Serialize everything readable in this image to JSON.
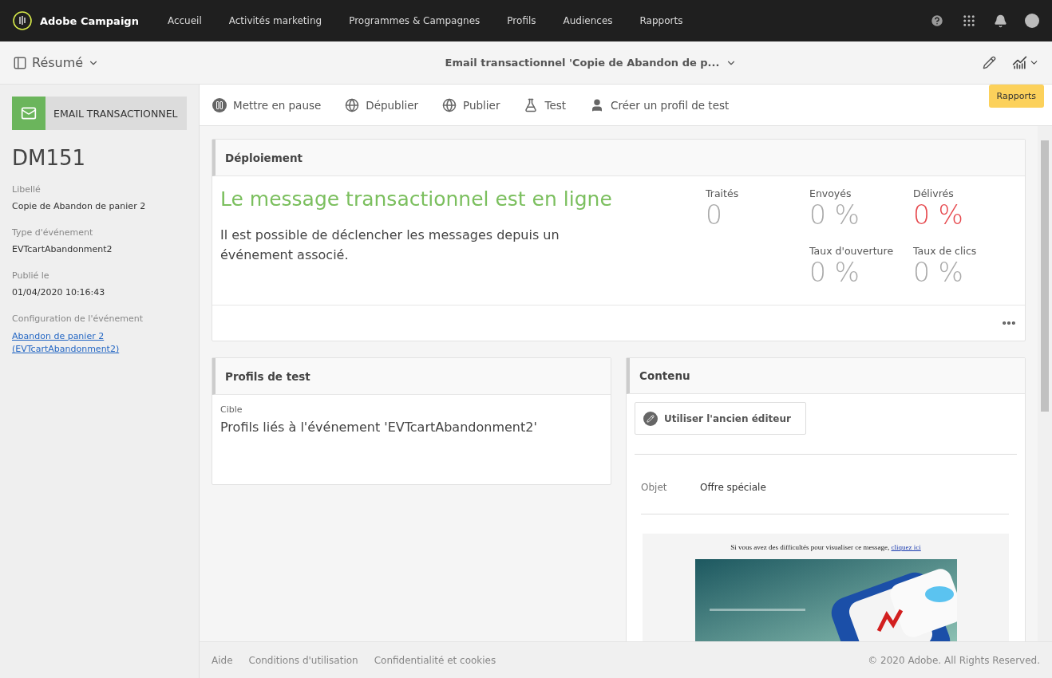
{
  "brand": "Adobe Campaign",
  "nav": [
    {
      "label": "Accueil",
      "selected": false
    },
    {
      "label": "Activités marketing",
      "selected": false
    },
    {
      "label": "Programmes & Campagnes",
      "selected": false
    },
    {
      "label": "Profils",
      "selected": false
    },
    {
      "label": "Audiences",
      "selected": false
    },
    {
      "label": "Rapports",
      "selected": false
    }
  ],
  "subbar": {
    "view": "Résumé",
    "title": "Email transactionnel 'Copie de Abandon de p...",
    "tooltip": "Rapports"
  },
  "sidebar": {
    "badge": "EMAIL TRANSACTIONNEL",
    "id": "DM151",
    "fields": [
      {
        "label": "Libellé",
        "value": "Copie de Abandon de panier 2",
        "kind": "text"
      },
      {
        "label": "Type d'événement",
        "value": "EVTcartAbandonment2",
        "kind": "text"
      },
      {
        "label": "Publié le",
        "value": "01/04/2020 10:16:43",
        "kind": "text"
      },
      {
        "label": "Configuration de l'événement",
        "value": "Abandon de panier 2 (EVTcartAbandonment2)",
        "kind": "link"
      }
    ]
  },
  "toolbar": [
    {
      "label": "Mettre en pause",
      "kind": "pause"
    },
    {
      "label": "Dépublier",
      "kind": "unpublish"
    },
    {
      "label": "Publier",
      "kind": "publish"
    },
    {
      "label": "Test",
      "kind": "test"
    },
    {
      "label": "Créer un profil de test",
      "kind": "profile"
    }
  ],
  "deployment": {
    "title": "Déploiement",
    "status": "Le message transactionnel est en ligne",
    "description": "Il est possible de déclencher les messages depuis un événement associé.",
    "stats": [
      {
        "label": "Traités",
        "value": "0",
        "alert": false
      },
      {
        "label": "Envoyés",
        "value": "0 %",
        "alert": false
      },
      {
        "label": "Délivrés",
        "value": "0 %",
        "alert": true
      },
      {
        "label": "Taux d'ouverture",
        "value": "0 %",
        "alert": false
      },
      {
        "label": "Taux de clics",
        "value": "0 %",
        "alert": false
      }
    ]
  },
  "test_profiles": {
    "title": "Profils de test",
    "label": "Cible",
    "value": "Profils liés à l'événement 'EVTcartAbandonment2'"
  },
  "content": {
    "title": "Contenu",
    "button": "Utiliser l'ancien éditeur",
    "subject_label": "Objet",
    "subject": "Offre spéciale",
    "preview_notice": "Si vous avez des difficultés pour visualiser ce message,",
    "preview_link": "cliquez ici"
  },
  "footer": {
    "links": [
      "Aide",
      "Conditions d'utilisation",
      "Confidentialité et cookies"
    ],
    "copyright": "© 2020 Adobe. All Rights Reserved."
  }
}
